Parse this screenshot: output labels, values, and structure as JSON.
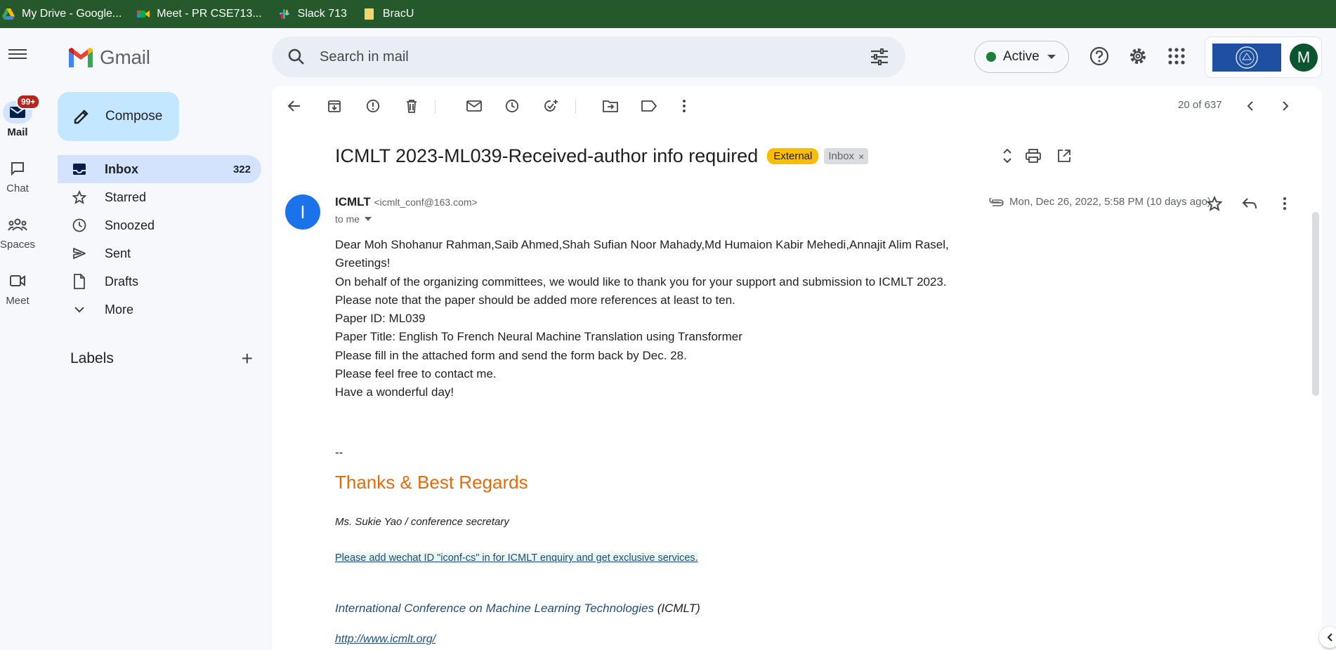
{
  "bookmarks": [
    {
      "label": "My Drive - Google...",
      "icon": "google-drive-icon"
    },
    {
      "label": "Meet - PR CSE713...",
      "icon": "google-meet-icon"
    },
    {
      "label": "Slack 713",
      "icon": "slack-icon"
    },
    {
      "label": "BracU",
      "icon": "folder-icon"
    }
  ],
  "rail": {
    "mail": "Mail",
    "mail_badge": "99+",
    "chat": "Chat",
    "spaces": "Spaces",
    "meet": "Meet"
  },
  "brand": "Gmail",
  "compose": "Compose",
  "nav": [
    {
      "label": "Inbox",
      "count": "322"
    },
    {
      "label": "Starred"
    },
    {
      "label": "Snoozed"
    },
    {
      "label": "Sent"
    },
    {
      "label": "Drafts"
    },
    {
      "label": "More"
    }
  ],
  "labels_heading": "Labels",
  "search": {
    "placeholder": "Search in mail"
  },
  "status": "Active",
  "avatar_letter": "M",
  "pager": "20 of 637",
  "email": {
    "subject": "ICMLT 2023-ML039-Received-author info required",
    "tag_external": "External",
    "tag_inbox": "Inbox",
    "sender_initial": "I",
    "sender_name": "ICMLT",
    "sender_email": "<icmlt_conf@163.com>",
    "to": "to me",
    "date": "Mon, Dec 26, 2022, 5:58 PM (10 days ago)",
    "body": [
      "Dear Moh Shohanur Rahman,Saib Ahmed,Shah Sufian Noor Mahady,Md Humaion Kabir Mehedi,Annajit Alim Rasel,",
      "Greetings!",
      "On behalf of the organizing committees, we would like to thank you for your support and submission to ICMLT 2023.",
      "Please note that the paper should be added more references at least to ten.",
      "Paper ID: ML039",
      "Paper Title: English To French Neural Machine Translation using Transformer",
      "Please fill in the attached form and send the form back by Dec. 28.",
      "Please feel free to contact me.",
      "Have a wonderful day!"
    ],
    "sig_dash": "--",
    "sig_thanks": "Thanks & Best Regards",
    "sig_name": "Ms. Sukie Yao  / conference secretary",
    "sig_wechat": "Please add wechat ID \"iconf-cs\" in for ICMLT enquiry and get exclusive services.",
    "sig_conf": "International Conference on Machine Learning Technologies",
    "sig_conf_abbr": "(ICMLT)",
    "sig_link": "http://www.icmlt.org/"
  }
}
